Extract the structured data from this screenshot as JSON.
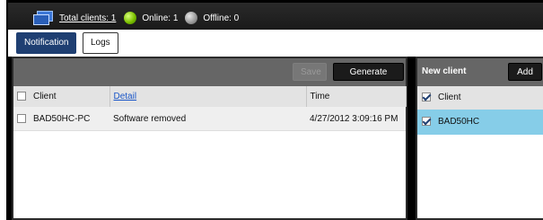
{
  "status": {
    "total_clients": "Total clients: 1",
    "online": "Online: 1",
    "offline": "Offline: 0"
  },
  "tabs": [
    {
      "label": "Notification",
      "active": true
    },
    {
      "label": "Logs",
      "active": false
    }
  ],
  "left_panel": {
    "save_label": "Save",
    "generate_report_label": "Generate report",
    "columns": [
      "Client",
      "Detail",
      "Time"
    ],
    "rows": [
      {
        "client": "BAD50HC-PC",
        "detail": "Software removed",
        "time": "4/27/2012 3:09:16 PM",
        "checked": false
      }
    ]
  },
  "right_panel": {
    "title": "New client",
    "add_label": "Add",
    "column": "Client",
    "rows": [
      {
        "client": "BAD50HC",
        "checked": true
      }
    ]
  },
  "colors": {
    "active_tab": "#1f3f72",
    "selected_row": "#86cde8",
    "toolbar": "#666666"
  }
}
